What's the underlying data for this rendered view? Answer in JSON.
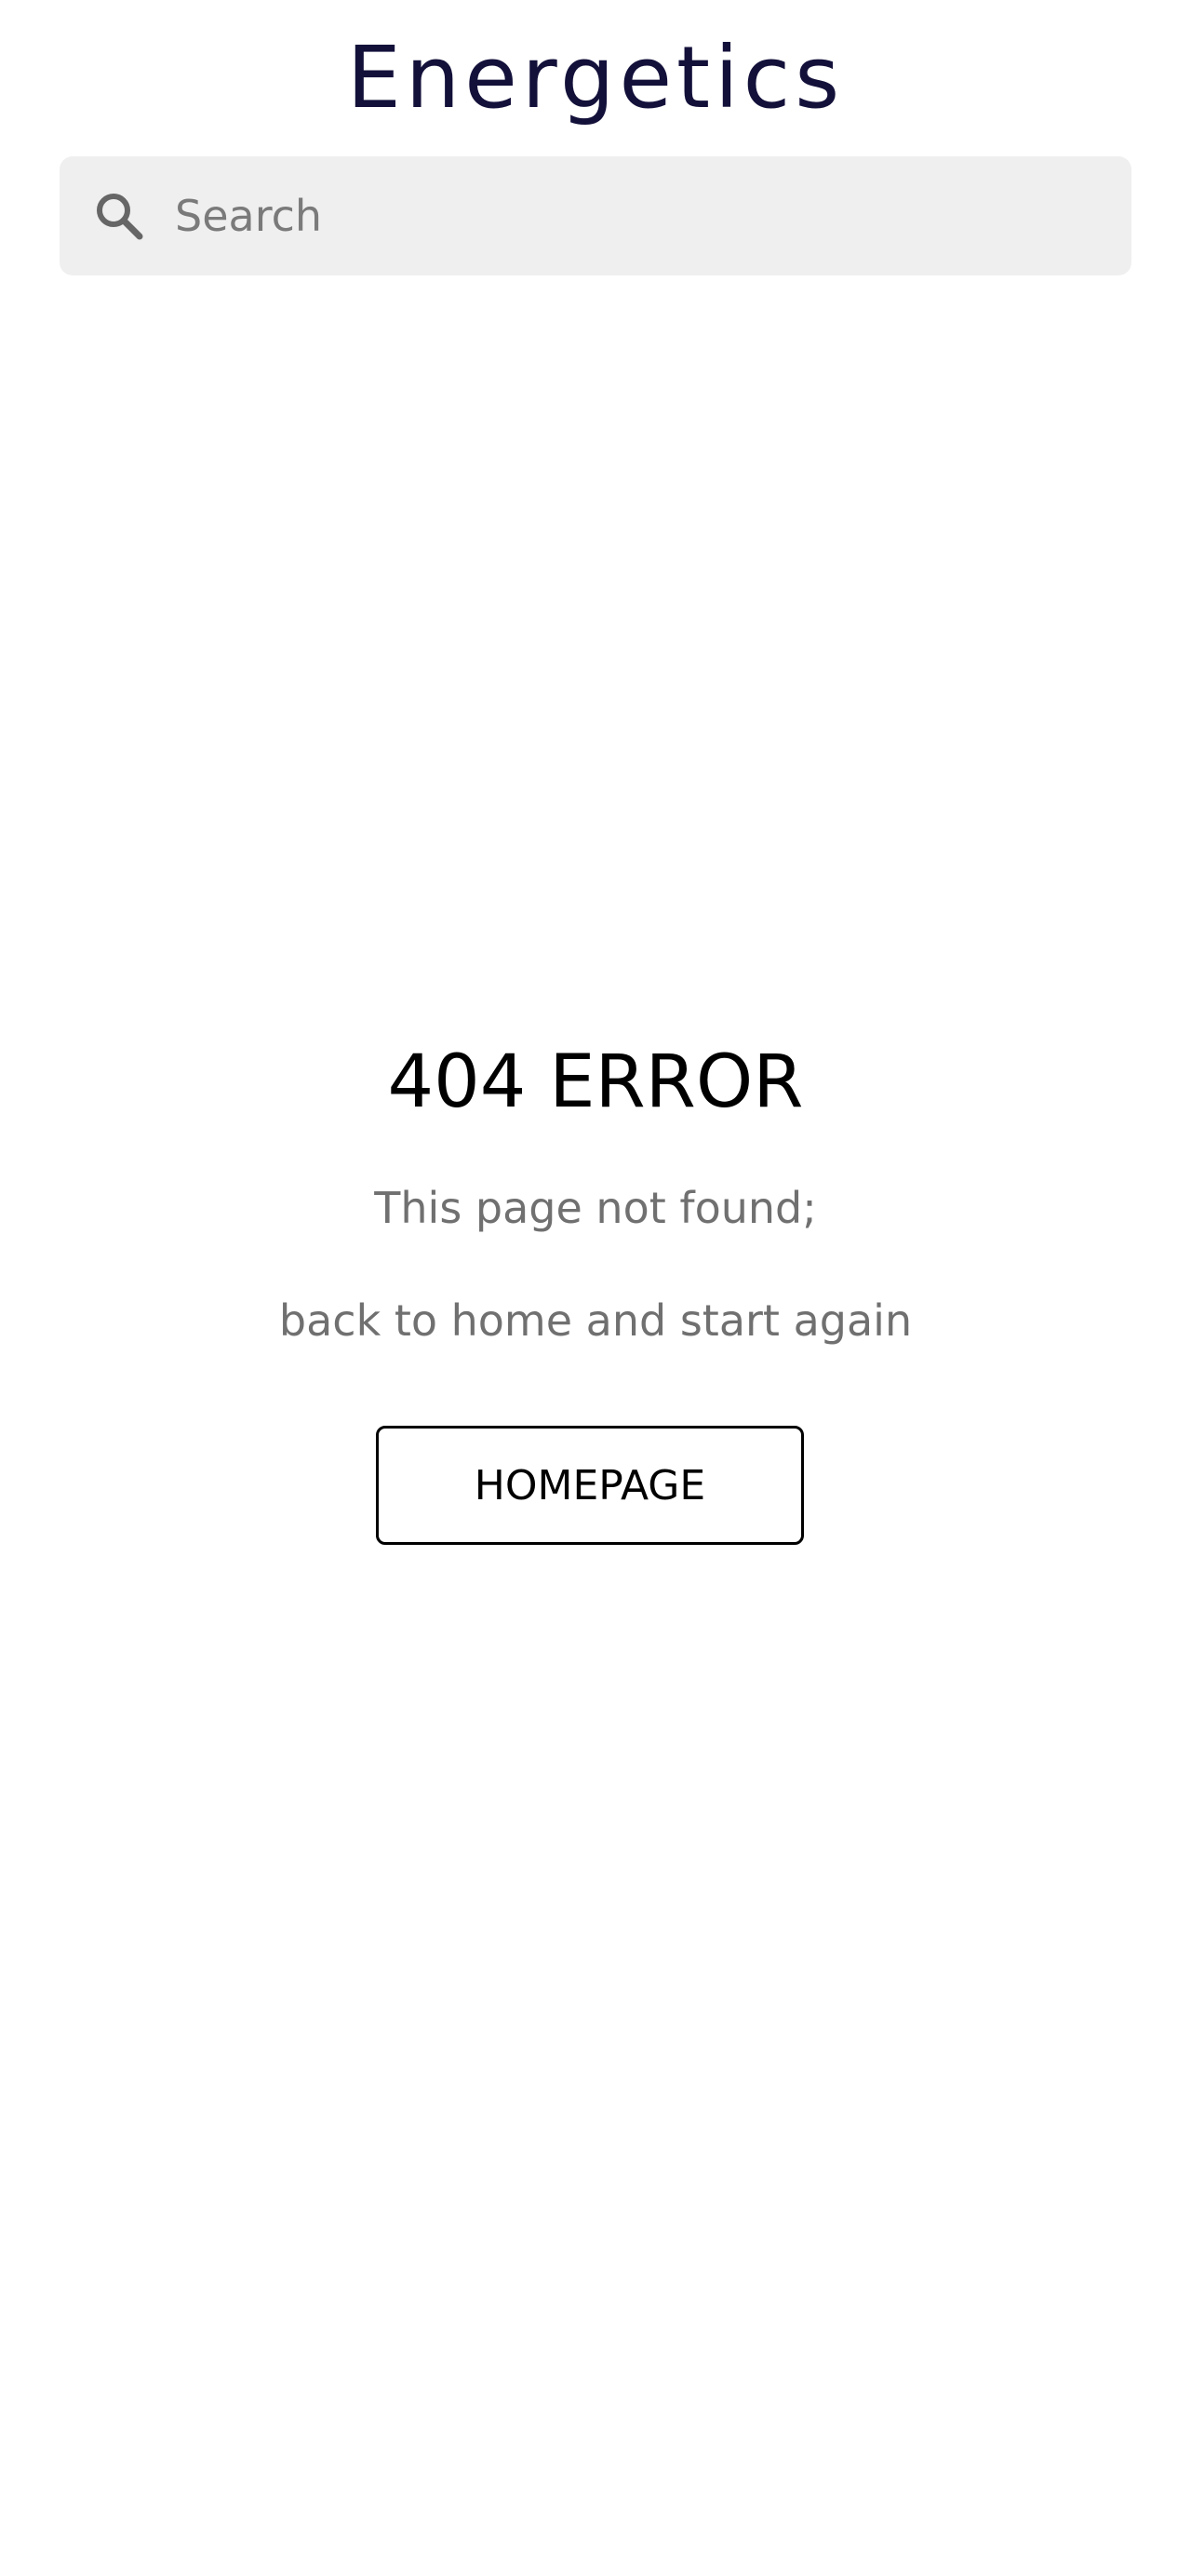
{
  "brand": {
    "logo_text": "Energetics",
    "color": "#13113a"
  },
  "search": {
    "placeholder": "Search",
    "value": "",
    "icon": "search-icon"
  },
  "error": {
    "title": "404 ERROR",
    "line1": "This page not found;",
    "line2": "back to home and start again"
  },
  "actions": {
    "homepage_label": "HOMEPAGE"
  }
}
